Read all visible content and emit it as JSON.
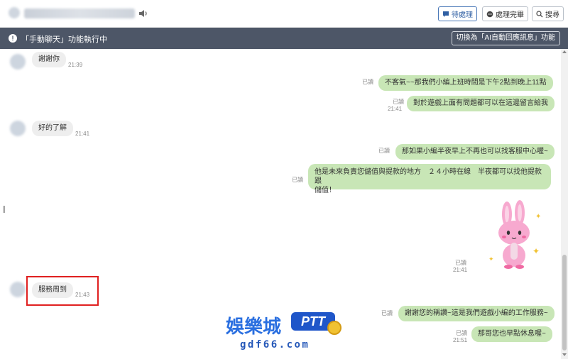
{
  "header": {
    "buttons": [
      {
        "label": "待處理",
        "icon": "chat-pending-icon"
      },
      {
        "label": "處理完畢",
        "icon": "chat-done-icon"
      },
      {
        "label": "搜尋",
        "icon": "search-icon"
      }
    ]
  },
  "status": {
    "icon": "info-icon",
    "text": "「手動聊天」功能執行中",
    "switch_label": "切換為「AI自動回應訊息」功能"
  },
  "messages": [
    {
      "side": "in",
      "text": "謝謝你",
      "time": "21:39"
    },
    {
      "side": "out",
      "read": "已讀",
      "time": "",
      "text": "不客氣~~那我們小編上班時間是下午2點到晚上11點"
    },
    {
      "side": "out",
      "read": "已讀",
      "time": "21:41",
      "text": "對於遊戲上面有問題都可以在這邊留言給我"
    },
    {
      "side": "in",
      "text": "好的了解",
      "time": "21:41"
    },
    {
      "side": "out",
      "read": "已讀",
      "time": "",
      "text": "那如果小編半夜早上不再也可以找客服中心喔~"
    },
    {
      "side": "out",
      "read": "已讀",
      "time": "",
      "text_line1": "他是未來負責您儲值與提款的地方　２４小時在線　半夜都可以找他提款跟",
      "text_line2": "儲值！"
    },
    {
      "side": "out",
      "read": "已讀",
      "time": "21:41",
      "sticker": "bunny-sticker"
    },
    {
      "side": "in",
      "text": "服務周到",
      "time": "21:43"
    },
    {
      "side": "out",
      "read": "已讀",
      "time": "",
      "text": "謝謝您的稱讚~這是我們遊戲小編的工作服務~"
    },
    {
      "side": "out",
      "read": "已讀",
      "time": "21:51",
      "text": "那哥您也早點休息喔~"
    }
  ],
  "watermark": {
    "brand": "娛樂城",
    "badge": "PTT",
    "url": "gdf66.com"
  },
  "colors": {
    "status_bar": "#4d5667",
    "bubble_out": "#c8e6b6",
    "bubble_in": "#eeeeee",
    "highlight": "#e02020",
    "primary": "#2f5fa3"
  }
}
